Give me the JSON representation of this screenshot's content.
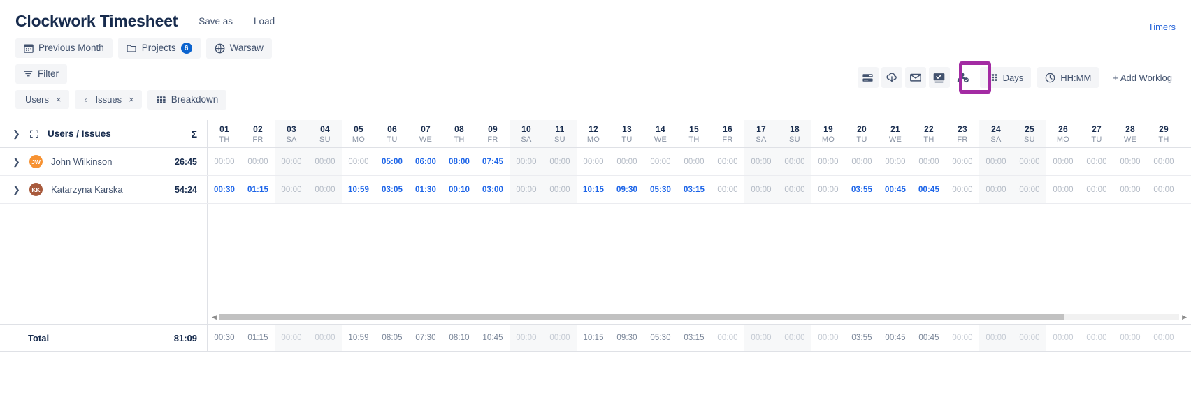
{
  "header": {
    "title": "Clockwork Timesheet",
    "save_as": "Save as",
    "load": "Load",
    "timers": "Timers"
  },
  "filters": {
    "previous_month": "Previous Month",
    "projects": "Projects",
    "projects_count": "6",
    "timezone": "Warsaw",
    "filter": "Filter"
  },
  "chips": {
    "users": "Users",
    "issues": "Issues",
    "breakdown": "Breakdown",
    "remove": "×",
    "prev": "‹"
  },
  "toolbar": {
    "icons": [
      "rows-icon",
      "cloud-download-icon",
      "email-icon",
      "screen-check-icon",
      "user-approve-icon"
    ],
    "days_label": "Days",
    "time_format_label": "HH:MM",
    "add_worklog_label": "+ Add Worklog",
    "highlight_color": "#a32ba3",
    "highlighted_icon": "screen-check-icon"
  },
  "table": {
    "left_header": "Users / Issues",
    "sum_symbol": "Σ",
    "days": [
      {
        "num": "01",
        "dow": "TH",
        "weekend": false
      },
      {
        "num": "02",
        "dow": "FR",
        "weekend": false
      },
      {
        "num": "03",
        "dow": "SA",
        "weekend": true
      },
      {
        "num": "04",
        "dow": "SU",
        "weekend": true
      },
      {
        "num": "05",
        "dow": "MO",
        "weekend": false
      },
      {
        "num": "06",
        "dow": "TU",
        "weekend": false
      },
      {
        "num": "07",
        "dow": "WE",
        "weekend": false
      },
      {
        "num": "08",
        "dow": "TH",
        "weekend": false
      },
      {
        "num": "09",
        "dow": "FR",
        "weekend": false
      },
      {
        "num": "10",
        "dow": "SA",
        "weekend": true
      },
      {
        "num": "11",
        "dow": "SU",
        "weekend": true
      },
      {
        "num": "12",
        "dow": "MO",
        "weekend": false
      },
      {
        "num": "13",
        "dow": "TU",
        "weekend": false
      },
      {
        "num": "14",
        "dow": "WE",
        "weekend": false
      },
      {
        "num": "15",
        "dow": "TH",
        "weekend": false
      },
      {
        "num": "16",
        "dow": "FR",
        "weekend": false
      },
      {
        "num": "17",
        "dow": "SA",
        "weekend": true
      },
      {
        "num": "18",
        "dow": "SU",
        "weekend": true
      },
      {
        "num": "19",
        "dow": "MO",
        "weekend": false
      },
      {
        "num": "20",
        "dow": "TU",
        "weekend": false
      },
      {
        "num": "21",
        "dow": "WE",
        "weekend": false
      },
      {
        "num": "22",
        "dow": "TH",
        "weekend": false
      },
      {
        "num": "23",
        "dow": "FR",
        "weekend": false
      },
      {
        "num": "24",
        "dow": "SA",
        "weekend": true
      },
      {
        "num": "25",
        "dow": "SU",
        "weekend": true
      },
      {
        "num": "26",
        "dow": "MO",
        "weekend": false
      },
      {
        "num": "27",
        "dow": "TU",
        "weekend": false
      },
      {
        "num": "28",
        "dow": "WE",
        "weekend": false
      },
      {
        "num": "29",
        "dow": "TH",
        "weekend": false
      }
    ],
    "rows": [
      {
        "name": "John Wilkinson",
        "initials": "JW",
        "avatar_color": "#f79232",
        "total": "26:45",
        "values": [
          "00:00",
          "00:00",
          "00:00",
          "00:00",
          "00:00",
          "05:00",
          "06:00",
          "08:00",
          "07:45",
          "00:00",
          "00:00",
          "00:00",
          "00:00",
          "00:00",
          "00:00",
          "00:00",
          "00:00",
          "00:00",
          "00:00",
          "00:00",
          "00:00",
          "00:00",
          "00:00",
          "00:00",
          "00:00",
          "00:00",
          "00:00",
          "00:00",
          "00:00"
        ]
      },
      {
        "name": "Katarzyna Karska",
        "initials": "KK",
        "avatar_color": "#a85a3c",
        "total": "54:24",
        "values": [
          "00:30",
          "01:15",
          "00:00",
          "00:00",
          "10:59",
          "03:05",
          "01:30",
          "00:10",
          "03:00",
          "00:00",
          "00:00",
          "10:15",
          "09:30",
          "05:30",
          "03:15",
          "00:00",
          "00:00",
          "00:00",
          "00:00",
          "03:55",
          "00:45",
          "00:45",
          "00:00",
          "00:00",
          "00:00",
          "00:00",
          "00:00",
          "00:00",
          "00:00"
        ]
      }
    ],
    "total": {
      "label": "Total",
      "sum": "81:09",
      "values": [
        "00:30",
        "01:15",
        "00:00",
        "00:00",
        "10:59",
        "08:05",
        "07:30",
        "08:10",
        "10:45",
        "00:00",
        "00:00",
        "10:15",
        "09:30",
        "05:30",
        "03:15",
        "00:00",
        "00:00",
        "00:00",
        "00:00",
        "03:55",
        "00:45",
        "00:45",
        "00:00",
        "00:00",
        "00:00",
        "00:00",
        "00:00",
        "00:00",
        "00:00"
      ]
    },
    "scrollbar": {
      "left_arrow": "◀",
      "right_arrow": "▶"
    }
  }
}
